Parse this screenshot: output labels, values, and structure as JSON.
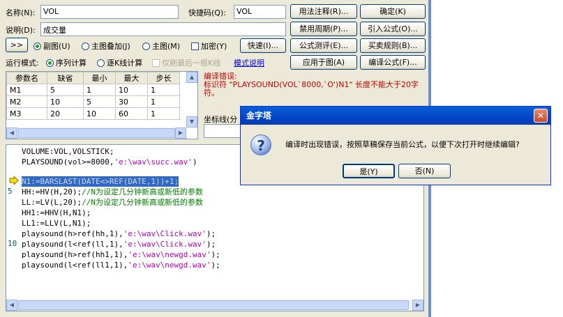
{
  "form": {
    "name_label": "名称(N):",
    "name_value": "VOL",
    "shortcut_label": "快捷码(Q):",
    "shortcut_value": "VOL",
    "desc_label": "说明(D):",
    "desc_value": "成交量",
    "expand_label": ">>",
    "radio_sub": "副图(U)",
    "radio_main_overlay": "主图叠加(J)",
    "radio_main": "主图(M)",
    "chk_encrypt": "加密(Y)",
    "quick_label": "快速(I)...",
    "run_mode_label": "运行模式:",
    "radio_seq": "序列计算",
    "radio_kline": "逐K线计算",
    "chk_last_only": "仅刷最后一根K线",
    "mode_desc_link": "模式说明",
    "axis_label": "坐标线(分"
  },
  "buttons": {
    "usage_note": "用法注释(R)...",
    "confirm": "确定(K)",
    "disable_period": "禁用周期(P)...",
    "import_formula": "引入公式(O)...",
    "formula_test": "公式测评(E)...",
    "trade_rule": "买卖规则(B)...",
    "apply_to_chart": "应用于图(A)",
    "compile": "编译公式(F)..."
  },
  "params": {
    "headers": [
      "参数名",
      "缺省",
      "最小",
      "最大",
      "步长"
    ],
    "rows": [
      [
        "M1",
        "5",
        "1",
        "10",
        "1"
      ],
      [
        "M2",
        "10",
        "5",
        "30",
        "1"
      ],
      [
        "M3",
        "20",
        "10",
        "60",
        "1"
      ]
    ]
  },
  "error": {
    "title": "编译错误:",
    "message": "标识符 \"PLAYSOUND(VOL`8000,`O')N1\" 长度不能大于20字符。"
  },
  "code": {
    "line1": "VOLUME:VOL,VOLSTICK;",
    "line2_fn": "PLAYSOUND(vol>=8000,",
    "line2_str": "'e:\\wav\\succ.wav'",
    "line2_end": ")",
    "line4": "N1:=BARSLAST(DATE<>REF(DATE,1))+1;",
    "line5": "HH:=HV(H,20);",
    "line5_cmt": "//N为设定几分钟新高或新低的参数",
    "line6": "LL:=LV(L,20);",
    "line6_cmt": "//N为设定几分钟新高或新低的参数",
    "line7": "HH1:=HHV(H,N1);",
    "line8": "LL1:=LLV(L,N1);",
    "line9_fn": "playsound(h>ref(hh,1),",
    "line9_str": "'e:\\wav\\Click.wav'",
    "line9_end": ");",
    "line10_fn": "playsound(l<ref(ll,1),",
    "line10_str": "'e:\\wav\\Click.wav'",
    "line10_end": ");",
    "line11_fn": "playsound(h>ref(hh1,1),",
    "line11_str": "'e:\\wav\\newgd.wav'",
    "line11_end": ");",
    "line12_fn": "playsound(l<ref(ll1,1),",
    "line12_str": "'e:\\wav\\newgd.wav'",
    "line12_end": ");",
    "ln5": "5",
    "ln10": "10"
  },
  "dialog": {
    "title": "金字塔",
    "message": "编译时出现错误，按照草稿保存当前公式，以便下次打开时继续编辑?",
    "yes": "是(Y)",
    "no": "否(N)"
  },
  "icons": {
    "dialog": "question-icon",
    "arrow": "current-line-arrow-icon"
  }
}
